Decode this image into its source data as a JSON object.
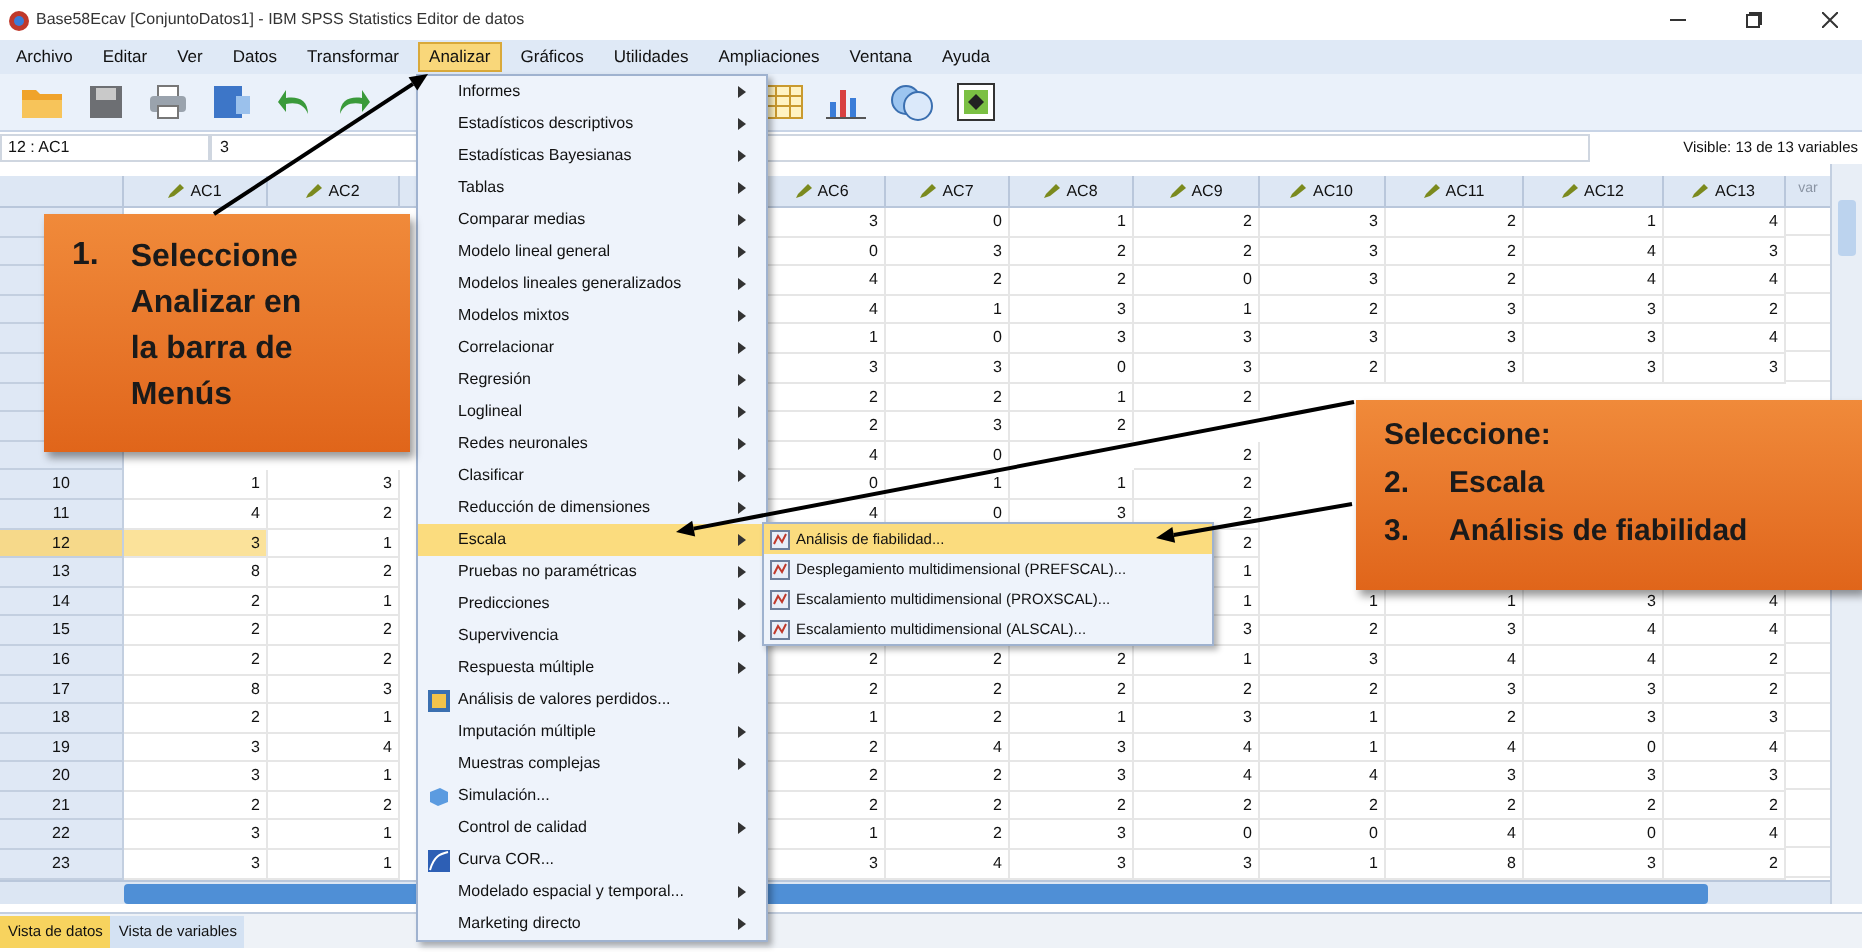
{
  "window": {
    "title": "Base58Ecav [ConjuntoDatos1] - IBM SPSS Statistics Editor de datos"
  },
  "menu_bar": [
    {
      "label": "Archivo",
      "selected": false
    },
    {
      "label": "Editar",
      "selected": false
    },
    {
      "label": "Ver",
      "selected": false
    },
    {
      "label": "Datos",
      "selected": false
    },
    {
      "label": "Transformar",
      "selected": false
    },
    {
      "label": "Analizar",
      "selected": true
    },
    {
      "label": "Gráficos",
      "selected": false
    },
    {
      "label": "Utilidades",
      "selected": false
    },
    {
      "label": "Ampliaciones",
      "selected": false
    },
    {
      "label": "Ventana",
      "selected": false
    },
    {
      "label": "Ayuda",
      "selected": false
    }
  ],
  "cell_reference": {
    "name": "12 : AC1",
    "value": "3"
  },
  "visible_variables": "Visible: 13 de 13 variables",
  "grid": {
    "columns": [
      "AC1",
      "AC2",
      "AC6",
      "AC7",
      "AC8",
      "AC9",
      "AC10",
      "AC11",
      "AC12",
      "AC13"
    ],
    "empty_column": "var",
    "rows": [
      {
        "selected": false,
        "cells": [
          null,
          null,
          "3",
          "0",
          "1",
          "2",
          "3",
          "2",
          "1",
          "4"
        ]
      },
      {
        "selected": false,
        "cells": [
          null,
          null,
          "0",
          "3",
          "2",
          "2",
          "3",
          "2",
          "4",
          "3"
        ]
      },
      {
        "selected": false,
        "cells": [
          null,
          null,
          "4",
          "2",
          "2",
          "0",
          "3",
          "2",
          "4",
          "4"
        ]
      },
      {
        "selected": false,
        "cells": [
          null,
          null,
          "4",
          "1",
          "3",
          "1",
          "2",
          "3",
          "3",
          "2"
        ]
      },
      {
        "selected": false,
        "cells": [
          null,
          null,
          "1",
          "0",
          "3",
          "3",
          "3",
          "3",
          "3",
          "4"
        ]
      },
      {
        "selected": false,
        "cells": [
          null,
          null,
          "3",
          "3",
          "0",
          "3",
          "2",
          "3",
          "3",
          "3"
        ]
      },
      {
        "selected": false,
        "cells": [
          null,
          null,
          "2",
          "2",
          "1",
          "2",
          null,
          null,
          null,
          null
        ]
      },
      {
        "selected": false,
        "cells": [
          null,
          null,
          "2",
          "3",
          "2",
          null,
          null,
          null,
          null,
          null
        ]
      },
      {
        "selected": false,
        "cells": [
          null,
          null,
          "4",
          "0",
          null,
          "2",
          null,
          null,
          null,
          null
        ]
      },
      {
        "number": "10",
        "selected": false,
        "cells": [
          "1",
          "3",
          "0",
          "1",
          "1",
          "2",
          null,
          null,
          null,
          null
        ]
      },
      {
        "number": "11",
        "selected": false,
        "cells": [
          "4",
          "2",
          "4",
          "0",
          "3",
          "2",
          null,
          null,
          null,
          null
        ]
      },
      {
        "number": "12",
        "selected": true,
        "cells": [
          "3",
          "1",
          null,
          null,
          null,
          "2",
          null,
          null,
          null,
          null
        ]
      },
      {
        "number": "13",
        "selected": false,
        "cells": [
          "8",
          "2",
          null,
          null,
          null,
          "1",
          null,
          null,
          null,
          null
        ]
      },
      {
        "number": "14",
        "selected": false,
        "cells": [
          "2",
          "1",
          null,
          null,
          null,
          "1",
          "1",
          "1",
          "3",
          "4"
        ]
      },
      {
        "number": "15",
        "selected": false,
        "cells": [
          "2",
          "2",
          null,
          null,
          null,
          "3",
          "2",
          "3",
          "4",
          "4"
        ]
      },
      {
        "number": "16",
        "selected": false,
        "cells": [
          "2",
          "2",
          "2",
          "2",
          "2",
          "1",
          "3",
          "4",
          "4",
          "2"
        ]
      },
      {
        "number": "17",
        "selected": false,
        "cells": [
          "8",
          "3",
          "2",
          "2",
          "2",
          "2",
          "2",
          "3",
          "3",
          "2"
        ]
      },
      {
        "number": "18",
        "selected": false,
        "cells": [
          "2",
          "1",
          "1",
          "2",
          "1",
          "3",
          "1",
          "2",
          "3",
          "3"
        ]
      },
      {
        "number": "19",
        "selected": false,
        "cells": [
          "3",
          "4",
          "2",
          "4",
          "3",
          "4",
          "1",
          "4",
          "0",
          "4"
        ]
      },
      {
        "number": "20",
        "selected": false,
        "cells": [
          "3",
          "1",
          "2",
          "2",
          "3",
          "4",
          "4",
          "3",
          "3",
          "3"
        ]
      },
      {
        "number": "21",
        "selected": false,
        "cells": [
          "2",
          "2",
          "2",
          "2",
          "2",
          "2",
          "2",
          "2",
          "2",
          "2"
        ]
      },
      {
        "number": "22",
        "selected": false,
        "cells": [
          "3",
          "1",
          "1",
          "2",
          "3",
          "0",
          "0",
          "4",
          "0",
          "4"
        ]
      },
      {
        "number": "23",
        "selected": false,
        "cells": [
          "3",
          "1",
          "3",
          "4",
          "3",
          "3",
          "1",
          "8",
          "3",
          "2"
        ]
      }
    ]
  },
  "analyze_menu": [
    {
      "label": "Informes",
      "kind": "submenu",
      "selected": false
    },
    {
      "label": "Estadísticos descriptivos",
      "kind": "submenu",
      "selected": false
    },
    {
      "label": "Estadísticas Bayesianas",
      "kind": "submenu",
      "selected": false
    },
    {
      "label": "Tablas",
      "kind": "submenu",
      "selected": false
    },
    {
      "label": "Comparar medias",
      "kind": "submenu",
      "selected": false
    },
    {
      "label": "Modelo lineal general",
      "kind": "submenu",
      "selected": false
    },
    {
      "label": "Modelos lineales generalizados",
      "kind": "submenu",
      "selected": false
    },
    {
      "label": "Modelos mixtos",
      "kind": "submenu",
      "selected": false
    },
    {
      "label": "Correlacionar",
      "kind": "submenu",
      "selected": false
    },
    {
      "label": "Regresión",
      "kind": "submenu",
      "selected": false
    },
    {
      "label": "Loglineal",
      "kind": "submenu",
      "selected": false
    },
    {
      "label": "Redes neuronales",
      "kind": "submenu",
      "selected": false
    },
    {
      "label": "Clasificar",
      "kind": "submenu",
      "selected": false
    },
    {
      "label": "Reducción de dimensiones",
      "kind": "submenu",
      "selected": false
    },
    {
      "label": "Escala",
      "kind": "submenu",
      "selected": true
    },
    {
      "label": "Pruebas no paramétricas",
      "kind": "submenu",
      "selected": false
    },
    {
      "label": "Predicciones",
      "kind": "submenu",
      "selected": false
    },
    {
      "label": "Supervivencia",
      "kind": "submenu",
      "selected": false
    },
    {
      "label": "Respuesta múltiple",
      "kind": "submenu",
      "selected": false
    },
    {
      "label": "Análisis de valores perdidos...",
      "kind": "command",
      "selected": false
    },
    {
      "label": "Imputación múltiple",
      "kind": "submenu",
      "selected": false
    },
    {
      "label": "Muestras complejas",
      "kind": "submenu",
      "selected": false
    },
    {
      "label": "Simulación...",
      "kind": "command",
      "selected": false
    },
    {
      "label": "Control de calidad",
      "kind": "submenu",
      "selected": false
    },
    {
      "label": "Curva COR...",
      "kind": "command",
      "selected": false
    },
    {
      "label": "Modelado espacial y temporal...",
      "kind": "submenu",
      "selected": false
    },
    {
      "label": "Marketing directo",
      "kind": "submenu",
      "selected": false
    }
  ],
  "scale_submenu": [
    {
      "label": "Análisis de fiabilidad...",
      "selected": true
    },
    {
      "label": "Desplegamiento multidimensional (PREFSCAL)...",
      "selected": false
    },
    {
      "label": "Escalamiento multidimensional (PROXSCAL)...",
      "selected": false
    },
    {
      "label": "Escalamiento multidimensional (ALSCAL)...",
      "selected": false
    }
  ],
  "callout_1": {
    "number": "1.",
    "text": "Seleccione Analizar en la barra de Menús"
  },
  "callout_2": {
    "heading": "Seleccione:",
    "steps": [
      {
        "number": "2.",
        "text": "Escala"
      },
      {
        "number": "3.",
        "text": "Análisis de fiabilidad"
      }
    ]
  },
  "view_tabs": [
    {
      "label": "Vista de datos",
      "selected": true
    },
    {
      "label": "Vista de variables",
      "selected": false
    }
  ]
}
